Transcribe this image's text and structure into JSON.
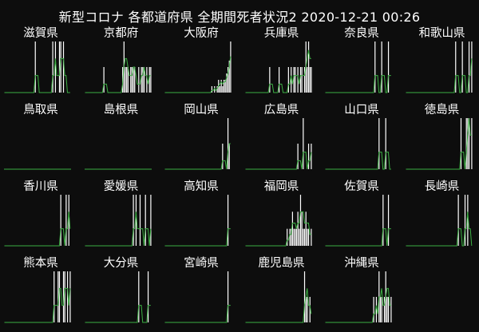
{
  "title": "新型コロナ 各都道府県 全期間死者状況2 2020-12-21 00:26",
  "colors": {
    "background": "#0d0d0d",
    "bar": "#ffffff",
    "line": "#3cb043",
    "text": "#ffffff"
  },
  "chart_data": [
    {
      "type": "bar+line",
      "name": "滋賀県",
      "values": [
        0,
        0,
        0,
        0,
        0,
        0,
        0,
        0,
        0,
        0,
        0,
        0,
        0,
        0,
        0,
        0,
        0,
        0,
        0,
        0,
        0,
        0,
        0,
        1,
        0,
        0,
        0,
        0,
        0,
        0,
        0,
        0,
        0,
        0,
        0,
        0,
        1,
        0,
        1,
        0,
        0,
        1,
        1,
        0,
        1,
        0,
        0,
        0,
        0,
        0
      ]
    },
    {
      "type": "bar+line",
      "name": "京都府",
      "values": [
        0,
        0,
        0,
        0,
        0,
        0,
        0,
        0,
        0,
        0,
        0,
        0,
        0,
        0,
        1,
        0,
        0,
        0,
        0,
        0,
        0,
        0,
        0,
        0,
        0,
        0,
        0,
        0,
        1,
        2,
        1,
        1,
        1,
        0,
        1,
        1,
        1,
        1,
        0,
        0,
        1,
        0,
        1,
        1,
        1,
        0,
        1,
        0,
        1,
        1
      ]
    },
    {
      "type": "bar+line",
      "name": "大阪府",
      "values": [
        0,
        0,
        0,
        0,
        0,
        0,
        0,
        0,
        0,
        0,
        0,
        0,
        0,
        0,
        0,
        0,
        0,
        0,
        0,
        0,
        0,
        0,
        0,
        0,
        0,
        0,
        0,
        0,
        0,
        0,
        0,
        0,
        0,
        0,
        0,
        1,
        0,
        1,
        0,
        1,
        2,
        1,
        2,
        1,
        2,
        2,
        3,
        4,
        5,
        8
      ]
    },
    {
      "type": "bar+line",
      "name": "兵庫県",
      "values": [
        0,
        0,
        0,
        0,
        0,
        0,
        0,
        0,
        0,
        0,
        0,
        0,
        0,
        0,
        0,
        0,
        0,
        0,
        1,
        0,
        0,
        0,
        0,
        0,
        0,
        1,
        0,
        0,
        0,
        0,
        0,
        0,
        1,
        0,
        1,
        0,
        1,
        1,
        0,
        1,
        0,
        1,
        1,
        0,
        1,
        2,
        1,
        2,
        1,
        1
      ]
    },
    {
      "type": "bar+line",
      "name": "奈良県",
      "values": [
        0,
        0,
        0,
        0,
        0,
        0,
        0,
        0,
        0,
        0,
        0,
        0,
        0,
        0,
        0,
        0,
        0,
        0,
        0,
        0,
        0,
        0,
        0,
        0,
        0,
        0,
        0,
        0,
        0,
        0,
        0,
        0,
        0,
        0,
        0,
        0,
        0,
        1,
        0,
        0,
        0,
        0,
        1,
        0,
        0,
        0,
        0,
        1,
        0,
        0
      ]
    },
    {
      "type": "bar+line",
      "name": "和歌山県",
      "values": [
        0,
        0,
        0,
        0,
        0,
        0,
        0,
        0,
        0,
        0,
        0,
        0,
        0,
        0,
        0,
        0,
        0,
        0,
        0,
        0,
        0,
        0,
        0,
        0,
        0,
        0,
        0,
        0,
        0,
        0,
        0,
        0,
        0,
        0,
        0,
        0,
        0,
        1,
        0,
        0,
        0,
        0,
        1,
        0,
        0,
        0,
        0,
        1,
        0,
        1
      ]
    },
    {
      "type": "bar+line",
      "name": "鳥取県",
      "values": []
    },
    {
      "type": "bar+line",
      "name": "島根県",
      "values": []
    },
    {
      "type": "bar+line",
      "name": "岡山県",
      "values": [
        0,
        0,
        0,
        0,
        0,
        0,
        0,
        0,
        0,
        0,
        0,
        0,
        0,
        0,
        0,
        0,
        0,
        0,
        0,
        0,
        0,
        0,
        0,
        0,
        0,
        0,
        0,
        0,
        0,
        0,
        0,
        0,
        0,
        0,
        0,
        0,
        0,
        0,
        0,
        0,
        0,
        0,
        0,
        1,
        0,
        0,
        0,
        2,
        1,
        0
      ]
    },
    {
      "type": "bar+line",
      "name": "広島県",
      "values": [
        0,
        0,
        0,
        0,
        0,
        0,
        0,
        0,
        0,
        0,
        0,
        0,
        0,
        0,
        0,
        0,
        0,
        0,
        0,
        0,
        0,
        0,
        0,
        0,
        0,
        0,
        0,
        0,
        0,
        0,
        0,
        0,
        0,
        0,
        0,
        0,
        0,
        0,
        0,
        1,
        0,
        0,
        0,
        2,
        0,
        0,
        0,
        1,
        0,
        1
      ]
    },
    {
      "type": "bar+line",
      "name": "山口県",
      "values": [
        0,
        0,
        0,
        0,
        0,
        0,
        0,
        0,
        0,
        0,
        0,
        0,
        0,
        0,
        0,
        0,
        0,
        0,
        0,
        0,
        0,
        0,
        0,
        0,
        0,
        0,
        0,
        0,
        0,
        0,
        0,
        0,
        0,
        0,
        0,
        0,
        0,
        0,
        0,
        0,
        1,
        0,
        0,
        0,
        0,
        1,
        0,
        0,
        0,
        0
      ]
    },
    {
      "type": "bar+line",
      "name": "徳島県",
      "values": [
        0,
        0,
        0,
        0,
        0,
        0,
        0,
        0,
        0,
        0,
        0,
        0,
        0,
        0,
        0,
        0,
        0,
        0,
        0,
        0,
        0,
        0,
        0,
        0,
        0,
        0,
        0,
        0,
        0,
        0,
        0,
        0,
        0,
        0,
        0,
        0,
        0,
        0,
        0,
        0,
        0,
        1,
        0,
        0,
        0,
        1,
        1,
        1,
        0,
        1
      ]
    },
    {
      "type": "bar+line",
      "name": "香川県",
      "values": [
        0,
        0,
        0,
        0,
        0,
        0,
        0,
        0,
        0,
        0,
        0,
        0,
        0,
        0,
        0,
        0,
        0,
        0,
        0,
        0,
        0,
        0,
        0,
        0,
        0,
        0,
        0,
        0,
        0,
        0,
        0,
        0,
        0,
        0,
        0,
        0,
        0,
        0,
        0,
        0,
        0,
        0,
        1,
        0,
        0,
        0,
        1,
        0,
        1,
        0
      ]
    },
    {
      "type": "bar+line",
      "name": "愛媛県",
      "values": [
        0,
        0,
        0,
        0,
        0,
        0,
        0,
        0,
        0,
        0,
        0,
        0,
        0,
        0,
        0,
        0,
        0,
        0,
        0,
        0,
        0,
        0,
        0,
        0,
        0,
        0,
        0,
        0,
        0,
        0,
        0,
        0,
        0,
        0,
        0,
        0,
        1,
        0,
        1,
        0,
        0,
        1,
        0,
        0,
        0,
        1,
        0,
        0,
        0,
        1
      ]
    },
    {
      "type": "bar+line",
      "name": "高知県",
      "values": [
        0,
        0,
        0,
        0,
        0,
        0,
        0,
        0,
        0,
        0,
        0,
        0,
        0,
        0,
        0,
        0,
        0,
        0,
        0,
        0,
        0,
        0,
        0,
        0,
        0,
        0,
        0,
        0,
        0,
        0,
        0,
        0,
        0,
        0,
        0,
        0,
        0,
        0,
        0,
        0,
        0,
        0,
        0,
        0,
        0,
        0,
        0,
        1,
        0,
        0
      ]
    },
    {
      "type": "bar+line",
      "name": "福岡県",
      "values": [
        0,
        0,
        0,
        0,
        0,
        0,
        0,
        0,
        0,
        0,
        0,
        0,
        0,
        0,
        0,
        0,
        0,
        0,
        0,
        0,
        0,
        0,
        0,
        0,
        0,
        0,
        0,
        0,
        0,
        0,
        0,
        1,
        0,
        1,
        1,
        2,
        1,
        1,
        1,
        2,
        1,
        3,
        2,
        1,
        1,
        2,
        1,
        1,
        0,
        1
      ]
    },
    {
      "type": "bar+line",
      "name": "佐賀県",
      "values": [
        0,
        0,
        0,
        0,
        0,
        0,
        0,
        0,
        0,
        0,
        0,
        0,
        0,
        0,
        0,
        0,
        0,
        0,
        0,
        0,
        0,
        0,
        0,
        0,
        0,
        0,
        0,
        0,
        0,
        0,
        0,
        0,
        0,
        0,
        0,
        0,
        0,
        0,
        0,
        0,
        0,
        0,
        0,
        1,
        0,
        0,
        0,
        1,
        0,
        0
      ]
    },
    {
      "type": "bar+line",
      "name": "長崎県",
      "values": [
        0,
        0,
        0,
        0,
        0,
        0,
        0,
        0,
        0,
        0,
        0,
        0,
        0,
        0,
        0,
        0,
        0,
        0,
        0,
        0,
        0,
        0,
        0,
        0,
        0,
        0,
        0,
        0,
        0,
        0,
        0,
        0,
        0,
        0,
        0,
        0,
        0,
        0,
        0,
        1,
        0,
        0,
        0,
        0,
        1,
        0,
        1,
        0,
        0,
        0
      ]
    },
    {
      "type": "bar+line",
      "name": "熊本県",
      "values": [
        0,
        0,
        0,
        0,
        0,
        0,
        0,
        0,
        0,
        0,
        0,
        0,
        0,
        0,
        0,
        0,
        0,
        0,
        0,
        0,
        0,
        0,
        0,
        0,
        0,
        0,
        0,
        0,
        0,
        0,
        0,
        0,
        0,
        0,
        0,
        0,
        0,
        1,
        0,
        0,
        1,
        1,
        0,
        0,
        1,
        1,
        0,
        1,
        0,
        1
      ]
    },
    {
      "type": "bar+line",
      "name": "大分県",
      "values": [
        0,
        0,
        0,
        0,
        0,
        0,
        0,
        0,
        0,
        0,
        0,
        0,
        0,
        0,
        0,
        0,
        0,
        0,
        0,
        0,
        0,
        0,
        0,
        0,
        0,
        0,
        0,
        0,
        0,
        0,
        0,
        0,
        0,
        0,
        0,
        0,
        0,
        0,
        0,
        0,
        1,
        0,
        0,
        0,
        0,
        0,
        0,
        1,
        0,
        0
      ]
    },
    {
      "type": "bar+line",
      "name": "宮崎県",
      "values": [
        0,
        0,
        0,
        0,
        0,
        0,
        0,
        0,
        0,
        0,
        0,
        0,
        0,
        0,
        0,
        0,
        0,
        0,
        0,
        0,
        0,
        0,
        0,
        0,
        0,
        0,
        0,
        0,
        0,
        0,
        0,
        0,
        0,
        0,
        0,
        0,
        0,
        0,
        0,
        0,
        0,
        0,
        0,
        0,
        0,
        0,
        0,
        1,
        0,
        0
      ]
    },
    {
      "type": "bar+line",
      "name": "鹿児島県",
      "values": [
        0,
        0,
        0,
        0,
        0,
        0,
        0,
        0,
        0,
        0,
        0,
        0,
        0,
        0,
        0,
        0,
        0,
        0,
        0,
        0,
        0,
        0,
        0,
        0,
        0,
        0,
        0,
        0,
        0,
        0,
        0,
        0,
        0,
        0,
        0,
        0,
        0,
        0,
        0,
        0,
        0,
        0,
        0,
        0,
        2,
        1,
        1,
        0,
        1,
        0
      ]
    },
    {
      "type": "bar+line",
      "name": "沖縄県",
      "values": [
        0,
        0,
        0,
        0,
        0,
        0,
        0,
        0,
        0,
        0,
        0,
        0,
        0,
        0,
        0,
        0,
        0,
        0,
        0,
        0,
        0,
        0,
        0,
        0,
        0,
        0,
        0,
        0,
        0,
        0,
        0,
        0,
        0,
        0,
        0,
        0,
        1,
        0,
        1,
        0,
        2,
        1,
        1,
        0,
        1,
        2,
        1,
        1,
        0,
        1
      ]
    }
  ]
}
